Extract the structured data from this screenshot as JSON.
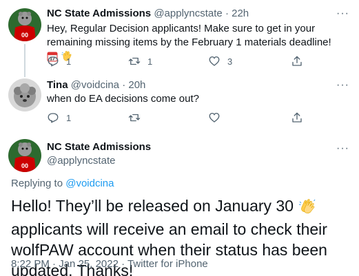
{
  "tweet1": {
    "name": "NC State Admissions",
    "handle": "@applyncstate",
    "separator": "·",
    "time": "22h",
    "text": "Hey, Regular Decision applicants! Make sure to get in your remaining missing items by the February 1 materials deadline!",
    "emoji": [
      "calendar-emoji",
      "waving-hand-emoji"
    ],
    "replies": "1",
    "retweets": "1",
    "likes": "3"
  },
  "tweet2": {
    "name": "Tina",
    "handle": "@voidcina",
    "separator": "·",
    "time": "20h",
    "text": "when do EA decisions come out?",
    "replies": "1"
  },
  "main": {
    "name": "NC State Admissions",
    "handle": "@applyncstate",
    "replying_label": "Replying to",
    "replying_to": "@voidcina",
    "text_before_emoji": "Hello! They’ll be released on January 30",
    "text_after_emoji": "applicants will receive an email to check their wolfPAW account when their status has been updated. Thanks!",
    "emoji": "clapping-hands-emoji",
    "time": "8:22 PM",
    "date": "Jan 25, 2022",
    "source": "Twitter for iPhone",
    "separator": "·"
  },
  "more_label": "···",
  "colors": {
    "text": "#0f1419",
    "secondary": "#536471",
    "link": "#1d9bf0",
    "thread_line": "#cfd9de",
    "nc_state_red": "#cc0000"
  }
}
